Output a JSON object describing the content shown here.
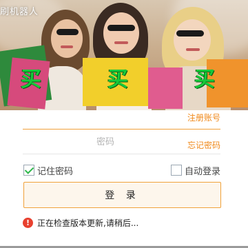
{
  "header": {
    "title": "刷机器人",
    "banner_glyphs": [
      "买",
      "买",
      "买"
    ]
  },
  "form": {
    "account_placeholder": "",
    "register_link": "注册账号",
    "password_placeholder": "密码",
    "forgot_link": "忘记密码",
    "remember_label": "记住密码",
    "remember_checked": true,
    "autologin_label": "自动登录",
    "autologin_checked": false,
    "login_label": "登 录"
  },
  "status": {
    "icon": "alert-circle-icon",
    "message": "正在检查版本更新,请稍后..."
  },
  "colors": {
    "accent": "#f08a1c",
    "check_green": "#2eb84b",
    "alert_red": "#e8402f"
  }
}
